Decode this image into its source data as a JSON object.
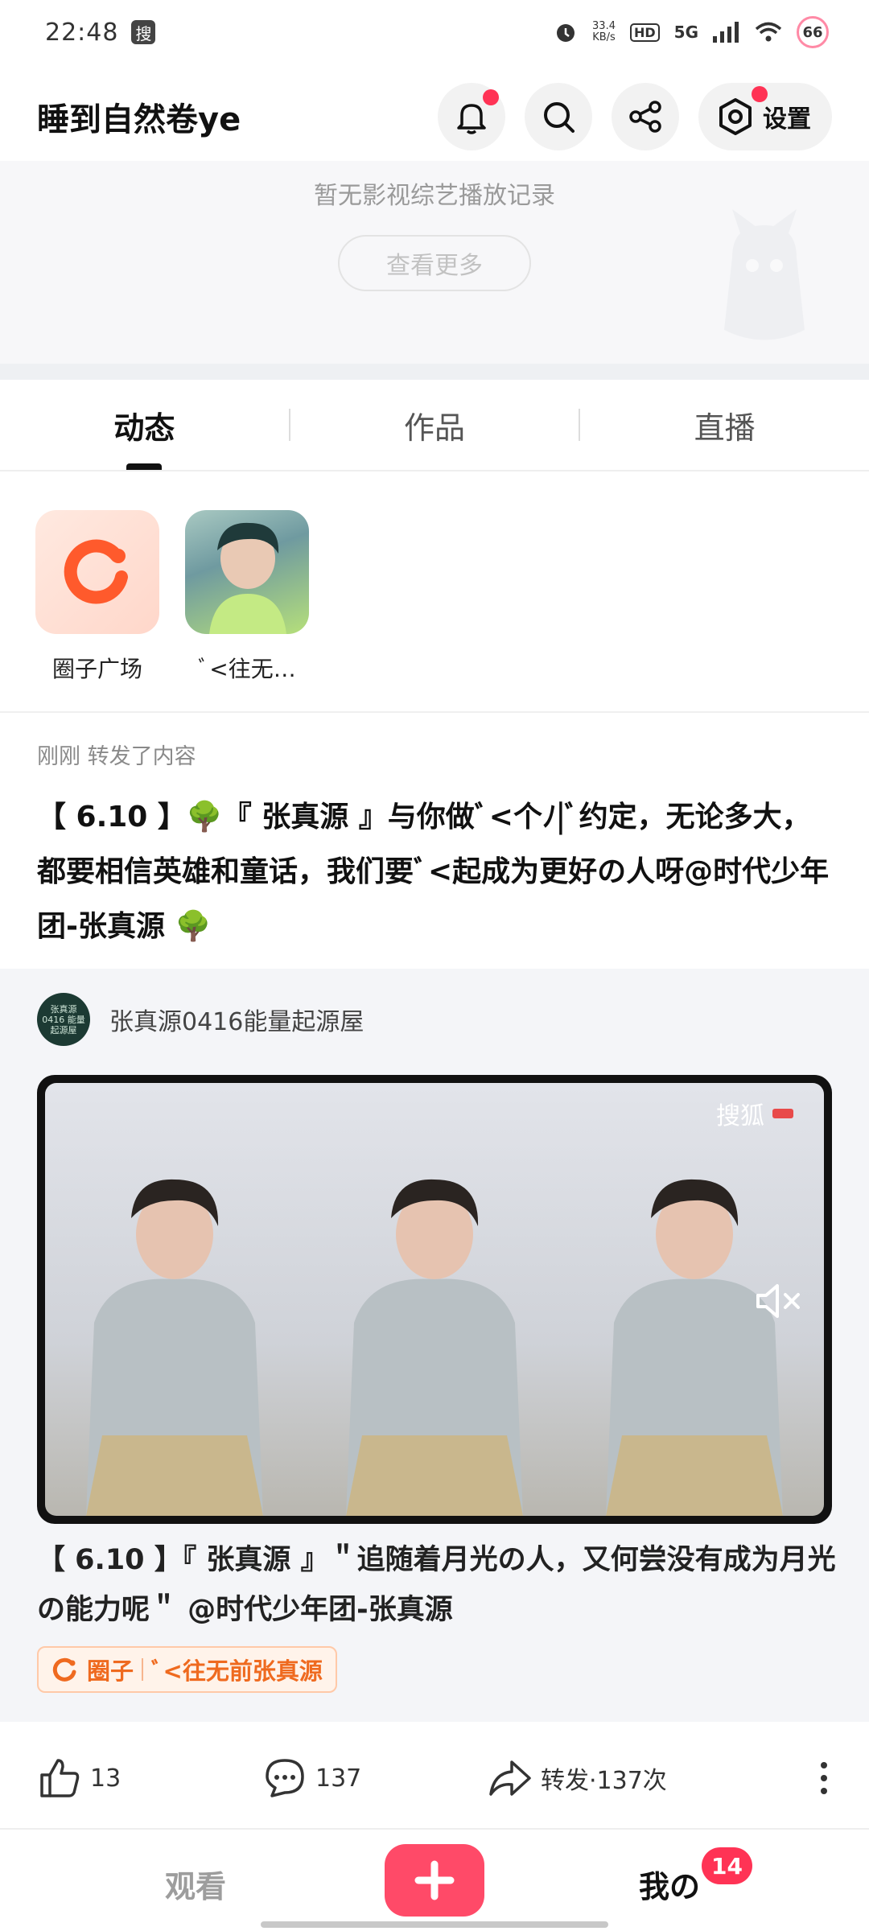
{
  "status_bar": {
    "time": "22:48",
    "app_icon_char": "搜",
    "net_speed_value": "33.4",
    "net_speed_unit": "KB/s",
    "hd": "HD",
    "network": "5G",
    "battery": "66"
  },
  "header": {
    "username": "睡到自然卷ye",
    "settings_label": "设置"
  },
  "history": {
    "empty_text": "暂无影视综艺播放记录",
    "more_label": "查看更多"
  },
  "tabs": [
    {
      "label": "动态",
      "active": true
    },
    {
      "label": "作品",
      "active": false
    },
    {
      "label": "直播",
      "active": false
    }
  ],
  "circles": [
    {
      "label": "圈子广场"
    },
    {
      "label": "ﾞ<往无…"
    }
  ],
  "post": {
    "meta": "刚刚 转发了内容",
    "text": "【 6.10 】🌳『 张真源 』与你做ﾞ<个ﾉ|ﾞ约定，无论多大，都要相信英雄和童话，我们要ﾞ<起成为更好の人呀@时代少年团-张真源 🌳"
  },
  "repost": {
    "author": "张真源0416能量起源屋",
    "avatar_text": "张真源0416 能量起源屋",
    "watermark": "搜狐",
    "text": "【 6.10 】『 张真源 』＂追随着月光の人，又何尝没有成为月光の能力呢＂ @时代少年团-张真源",
    "tag_label": "圈子",
    "tag_circle": "ﾞ<往无前张真源"
  },
  "actions": {
    "likes": "13",
    "comments": "137",
    "share_label": "转发·137次"
  },
  "bottom_nav": {
    "watch": "观看",
    "me": "我の",
    "me_badge": "14"
  },
  "colors": {
    "accent": "#ff4a68",
    "badge": "#ff3355",
    "tag_orange": "#ef6a1f"
  }
}
